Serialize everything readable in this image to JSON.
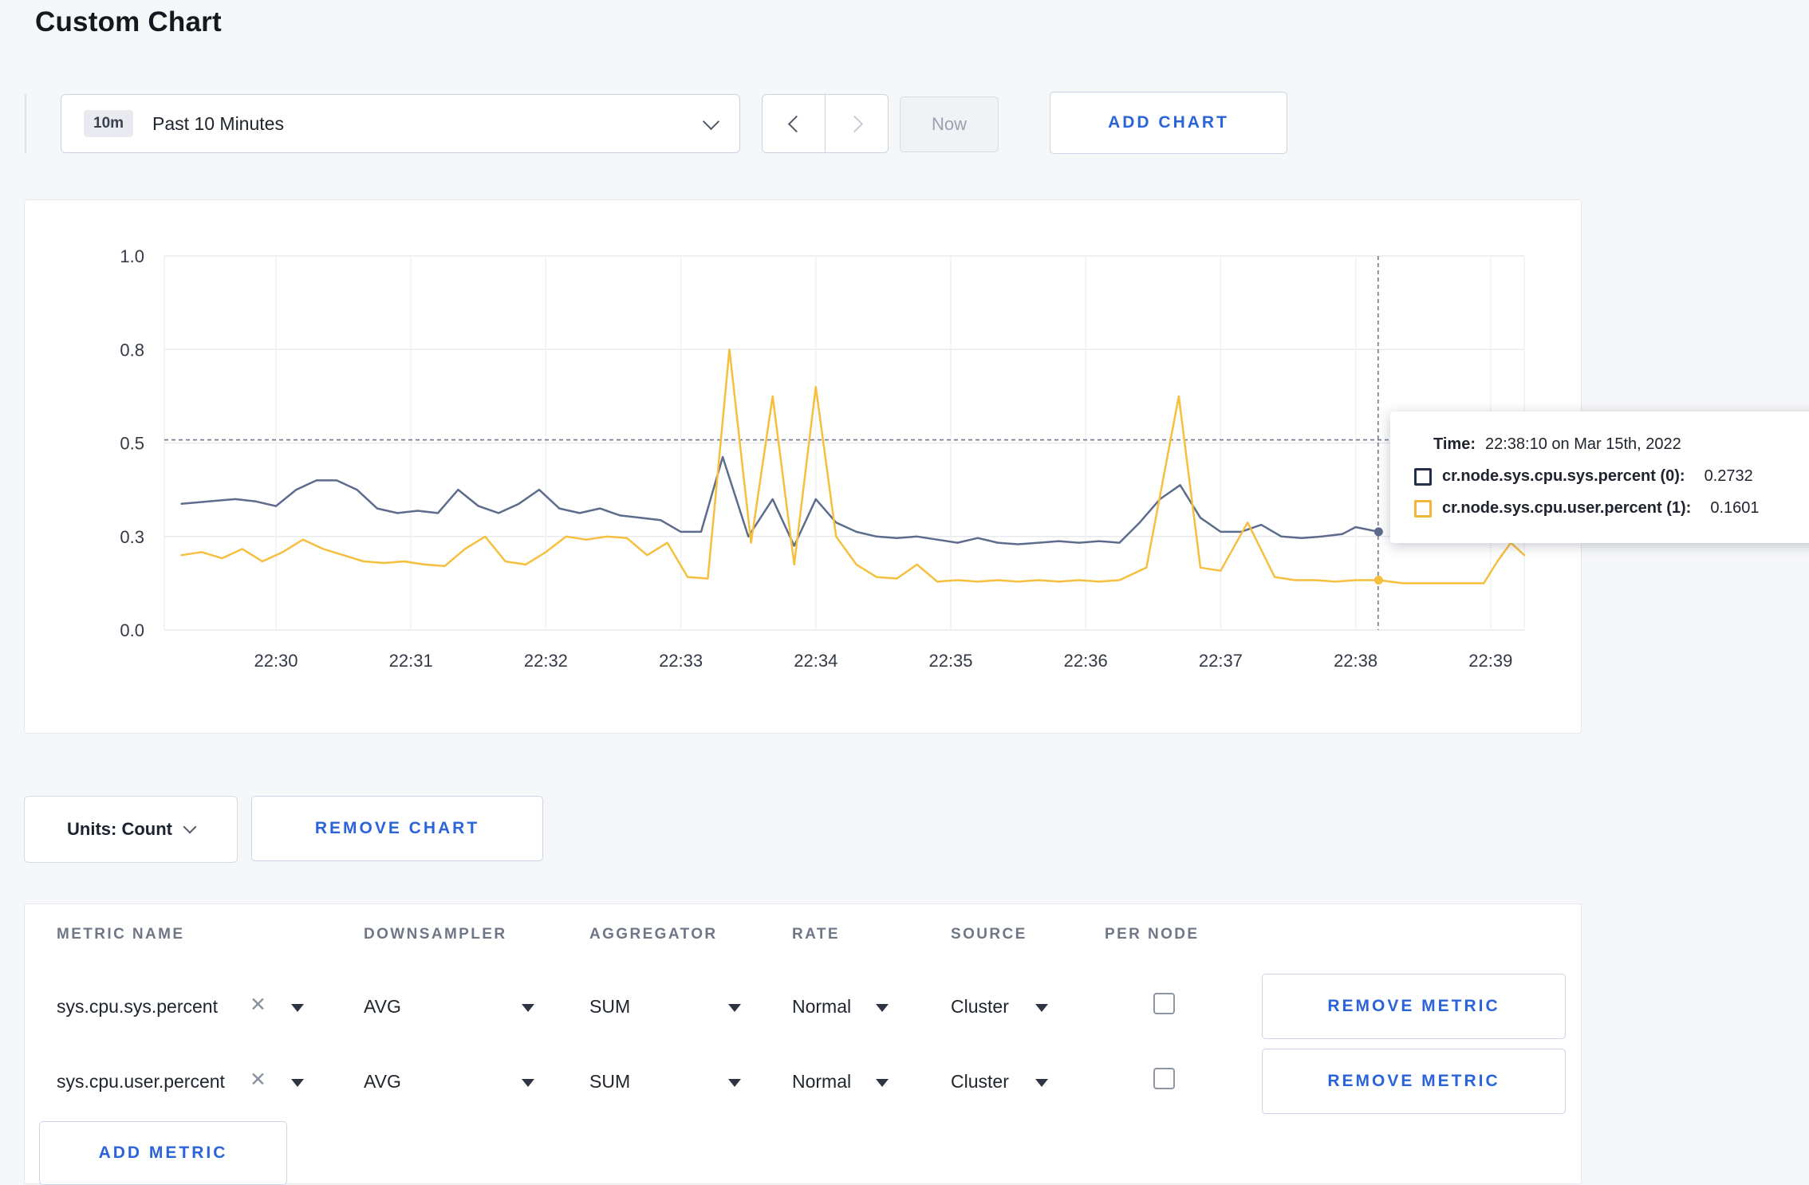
{
  "page": {
    "title": "Custom Chart"
  },
  "colors": {
    "accent_blue": "#2b63d9",
    "series_sys_line": "#5d6c8c",
    "series_sys_swatch": "#26304a",
    "series_user_line": "#f6bf3e",
    "series_user_swatch": "#f0b63a",
    "page_background": "#f6f7f9"
  },
  "icons": {
    "time_range": "chevron-down-icon",
    "prev": "chevron-left-icon",
    "next": "chevron-right-icon",
    "units": "chevron-down-icon",
    "metric_clear": "x-icon",
    "select_caret": "caret-down-icon"
  },
  "toolbar": {
    "time_range_badge": "10m",
    "time_range_label": "Past 10 Minutes",
    "now_label": "Now",
    "add_chart_label": "ADD CHART"
  },
  "chart_controls": {
    "units_label": "Units: Count",
    "remove_chart_label": "REMOVE CHART"
  },
  "tooltip": {
    "time_label": "Time:",
    "time_value": "22:38:10 on Mar 15th, 2022",
    "series": [
      {
        "label": "cr.node.sys.cpu.sys.percent (0):",
        "value": "0.2732",
        "swatch_color": "#26304a"
      },
      {
        "label": "cr.node.sys.cpu.user.percent (1):",
        "value": "0.1601",
        "swatch_color": "#f0b63a"
      }
    ]
  },
  "chart_data": {
    "type": "line",
    "title": "",
    "xlabel": "",
    "ylabel": "",
    "grid": true,
    "x_tick_labels": [
      "22:30",
      "22:31",
      "22:32",
      "22:33",
      "22:34",
      "22:35",
      "22:36",
      "22:37",
      "22:38",
      "22:39"
    ],
    "y_tick_values": [
      0.0,
      0.3,
      0.5,
      0.8,
      1.0
    ],
    "y_tick_labels": [
      "0.0",
      "0.3",
      "0.5",
      "0.8",
      "1.0"
    ],
    "x_domain_minutes": [
      29.25,
      39.25
    ],
    "hover_value_line": 0.51,
    "hover_time_minute": 38.1667,
    "series": [
      {
        "name": "cr.node.sys.cpu.sys.percent",
        "color": "#5d6c8c",
        "end_dot": [
          38.17,
          0.31
        ],
        "points": [
          [
            29.3,
            0.37
          ],
          [
            29.5,
            0.375
          ],
          [
            29.7,
            0.38
          ],
          [
            29.85,
            0.375
          ],
          [
            30.0,
            0.365
          ],
          [
            30.15,
            0.4
          ],
          [
            30.3,
            0.42
          ],
          [
            30.45,
            0.42
          ],
          [
            30.6,
            0.4
          ],
          [
            30.75,
            0.36
          ],
          [
            30.9,
            0.35
          ],
          [
            31.05,
            0.355
          ],
          [
            31.2,
            0.35
          ],
          [
            31.35,
            0.4
          ],
          [
            31.5,
            0.365
          ],
          [
            31.65,
            0.35
          ],
          [
            31.8,
            0.37
          ],
          [
            31.95,
            0.4
          ],
          [
            32.1,
            0.36
          ],
          [
            32.25,
            0.35
          ],
          [
            32.4,
            0.36
          ],
          [
            32.55,
            0.345
          ],
          [
            32.7,
            0.34
          ],
          [
            32.85,
            0.335
          ],
          [
            33.0,
            0.31
          ],
          [
            33.15,
            0.31
          ],
          [
            33.31,
            0.47
          ],
          [
            33.5,
            0.3
          ],
          [
            33.68,
            0.38
          ],
          [
            33.84,
            0.27
          ],
          [
            34.0,
            0.38
          ],
          [
            34.15,
            0.33
          ],
          [
            34.3,
            0.31
          ],
          [
            34.45,
            0.3
          ],
          [
            34.6,
            0.295
          ],
          [
            34.75,
            0.3
          ],
          [
            34.9,
            0.29
          ],
          [
            35.05,
            0.28
          ],
          [
            35.2,
            0.295
          ],
          [
            35.35,
            0.28
          ],
          [
            35.5,
            0.275
          ],
          [
            35.65,
            0.28
          ],
          [
            35.8,
            0.285
          ],
          [
            35.95,
            0.28
          ],
          [
            36.1,
            0.285
          ],
          [
            36.25,
            0.28
          ],
          [
            36.4,
            0.33
          ],
          [
            36.55,
            0.38
          ],
          [
            36.7,
            0.41
          ],
          [
            36.85,
            0.34
          ],
          [
            37.0,
            0.31
          ],
          [
            37.15,
            0.31
          ],
          [
            37.3,
            0.325
          ],
          [
            37.45,
            0.3
          ],
          [
            37.6,
            0.295
          ],
          [
            37.75,
            0.3
          ],
          [
            37.9,
            0.305
          ],
          [
            38.0,
            0.32
          ],
          [
            38.17,
            0.31
          ]
        ]
      },
      {
        "name": "cr.node.sys.cpu.user.percent",
        "color": "#f6bf3e",
        "end_dot": [
          38.17,
          0.16
        ],
        "points": [
          [
            29.3,
            0.24
          ],
          [
            29.45,
            0.25
          ],
          [
            29.6,
            0.23
          ],
          [
            29.75,
            0.26
          ],
          [
            29.9,
            0.22
          ],
          [
            30.05,
            0.25
          ],
          [
            30.2,
            0.29
          ],
          [
            30.35,
            0.26
          ],
          [
            30.5,
            0.24
          ],
          [
            30.65,
            0.22
          ],
          [
            30.8,
            0.215
          ],
          [
            30.95,
            0.22
          ],
          [
            31.1,
            0.21
          ],
          [
            31.25,
            0.205
          ],
          [
            31.4,
            0.26
          ],
          [
            31.55,
            0.3
          ],
          [
            31.7,
            0.22
          ],
          [
            31.85,
            0.21
          ],
          [
            32.0,
            0.25
          ],
          [
            32.15,
            0.3
          ],
          [
            32.3,
            0.29
          ],
          [
            32.45,
            0.3
          ],
          [
            32.6,
            0.295
          ],
          [
            32.75,
            0.24
          ],
          [
            32.9,
            0.28
          ],
          [
            33.05,
            0.17
          ],
          [
            33.2,
            0.165
          ],
          [
            33.36,
            0.8
          ],
          [
            33.52,
            0.28
          ],
          [
            33.68,
            0.65
          ],
          [
            33.84,
            0.21
          ],
          [
            34.0,
            0.68
          ],
          [
            34.15,
            0.3
          ],
          [
            34.3,
            0.21
          ],
          [
            34.45,
            0.17
          ],
          [
            34.6,
            0.165
          ],
          [
            34.75,
            0.21
          ],
          [
            34.9,
            0.155
          ],
          [
            35.05,
            0.16
          ],
          [
            35.2,
            0.155
          ],
          [
            35.35,
            0.16
          ],
          [
            35.5,
            0.155
          ],
          [
            35.65,
            0.16
          ],
          [
            35.8,
            0.155
          ],
          [
            35.95,
            0.16
          ],
          [
            36.1,
            0.155
          ],
          [
            36.25,
            0.16
          ],
          [
            36.45,
            0.2
          ],
          [
            36.69,
            0.65
          ],
          [
            36.85,
            0.2
          ],
          [
            37.0,
            0.19
          ],
          [
            37.2,
            0.33
          ],
          [
            37.4,
            0.17
          ],
          [
            37.55,
            0.16
          ],
          [
            37.7,
            0.16
          ],
          [
            37.85,
            0.155
          ],
          [
            38.0,
            0.16
          ],
          [
            38.17,
            0.16
          ],
          [
            38.35,
            0.15
          ],
          [
            38.55,
            0.15
          ],
          [
            38.75,
            0.15
          ],
          [
            38.95,
            0.15
          ],
          [
            39.05,
            0.22
          ],
          [
            39.15,
            0.28
          ],
          [
            39.25,
            0.24
          ]
        ]
      }
    ]
  },
  "metrics_table": {
    "headers": [
      "METRIC NAME",
      "DOWNSAMPLER",
      "AGGREGATOR",
      "RATE",
      "SOURCE",
      "PER NODE"
    ],
    "rows": [
      {
        "metric": "sys.cpu.sys.percent",
        "downsampler": "AVG",
        "aggregator": "SUM",
        "rate": "Normal",
        "source": "Cluster",
        "per_node_checked": false,
        "remove_label": "REMOVE METRIC"
      },
      {
        "metric": "sys.cpu.user.percent",
        "downsampler": "AVG",
        "aggregator": "SUM",
        "rate": "Normal",
        "source": "Cluster",
        "per_node_checked": false,
        "remove_label": "REMOVE METRIC"
      }
    ],
    "add_metric_label": "ADD METRIC"
  }
}
